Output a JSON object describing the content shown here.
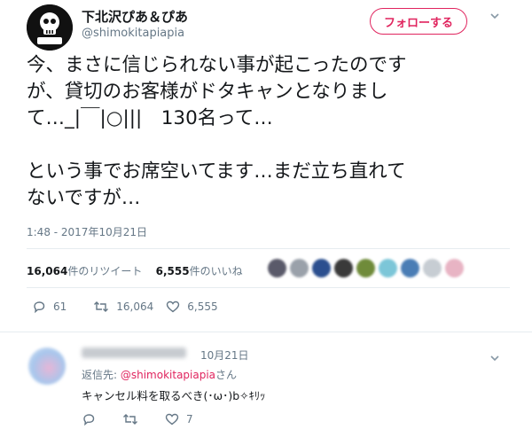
{
  "header": {
    "display_name": "下北沢ぴあ＆ぴあ",
    "handle": "@shimokitapiapia",
    "follow_label": "フォローする"
  },
  "tweet": {
    "text": "今、まさに信じられない事が起こったのです\nが、貸切のお客様がドタキャンとなりまし\nて…_|￣|○|||　130名って…\n\nという事でお席空いてます…まだ立ち直れて\nないですが…",
    "timestamp": "1:48 - 2017年10月21日"
  },
  "stats": {
    "retweets_count": "16,064",
    "retweets_label": "件のリツイート",
    "likes_count": "6,555",
    "likes_label": "件のいいね",
    "liker_colors": [
      "#5a5a6a",
      "#9aa1aa",
      "#2b4f8f",
      "#3a3a3a",
      "#6f8b3a",
      "#7cc6d8",
      "#4a7db5",
      "#c7cdd3",
      "#e8b4c4"
    ]
  },
  "actions": {
    "reply_count": "61",
    "retweet_count": "16,064",
    "like_count": "6,555"
  },
  "reply": {
    "date": "10月21日",
    "reply_to_prefix": "返信先: ",
    "reply_to_mention": "@shimokitapiapia",
    "reply_to_suffix": "さん",
    "text": "キャンセル料を取るべき(･ω･)b✧ｷﾘｯ",
    "like_count": "7"
  },
  "colors": {
    "accent": "#e0245e",
    "muted": "#657786",
    "text": "#14171a"
  }
}
